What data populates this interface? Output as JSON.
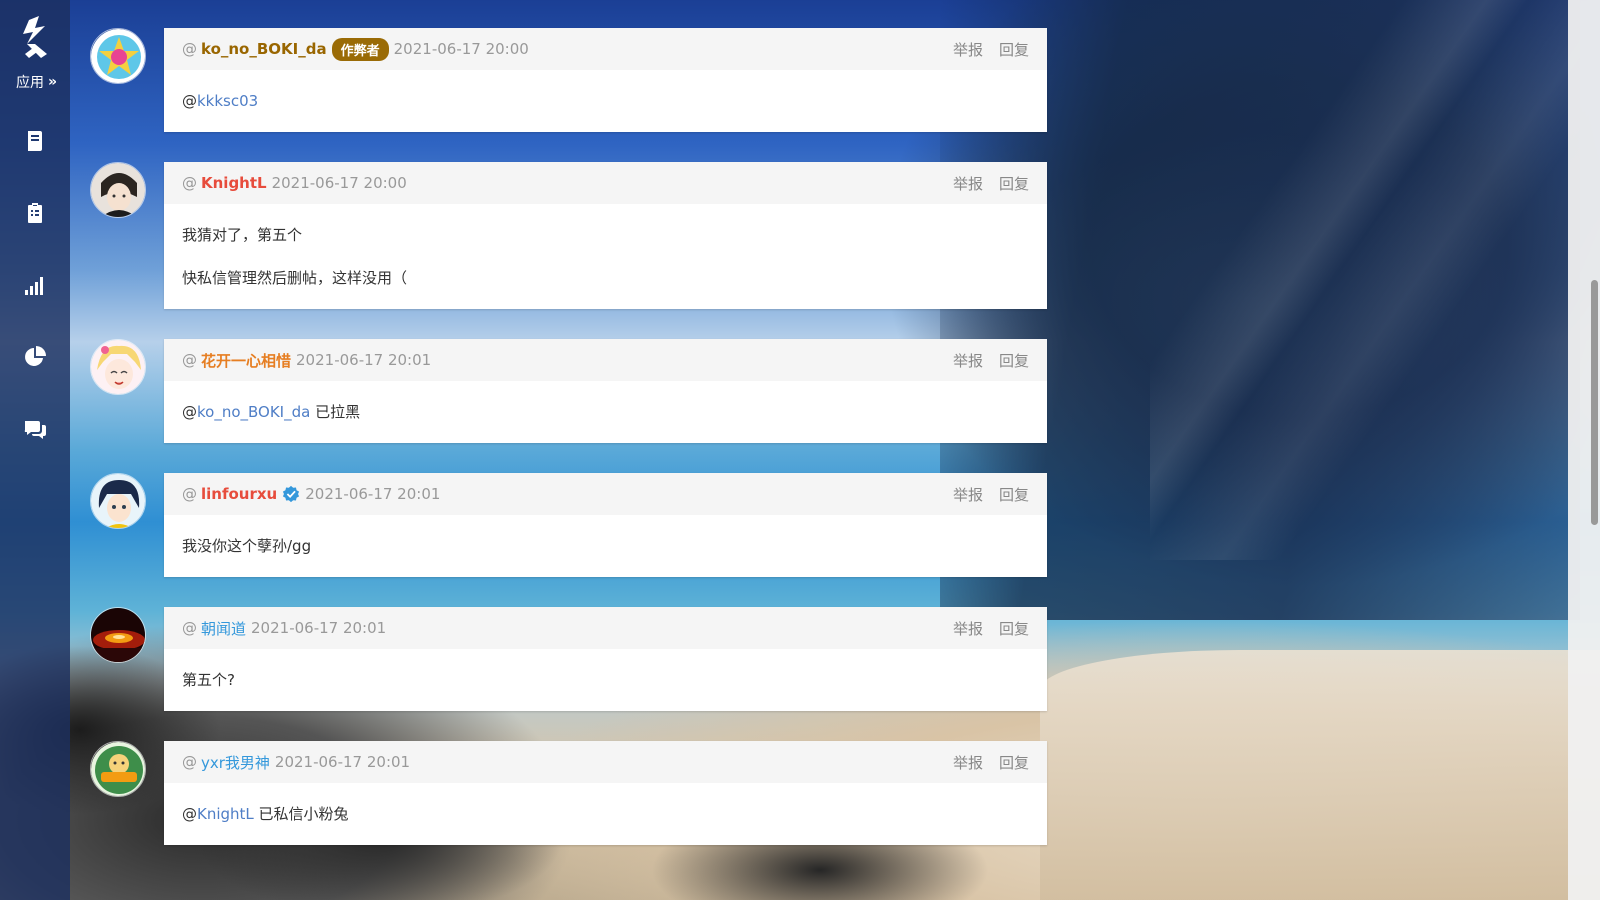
{
  "sidebar": {
    "logo_icon": "luogu-logo-icon",
    "app_label": "应用",
    "app_chevron": "»",
    "nav": [
      {
        "name": "problems-book-icon"
      },
      {
        "name": "clipboard-list-icon"
      },
      {
        "name": "signal-bars-icon"
      },
      {
        "name": "pie-chart-icon"
      },
      {
        "name": "comments-icon"
      }
    ]
  },
  "labels": {
    "at": "@",
    "report": "举报",
    "reply": "回复",
    "cheater_badge": "作弊者"
  },
  "comments": [
    {
      "username": "ko_no_BOKI_da",
      "name_color": "#996600",
      "badge": "作弊者",
      "time": "2021-06-17 20:00",
      "lines": [
        {
          "mention": "kkksc03",
          "text": ""
        }
      ]
    },
    {
      "username": "KnightL",
      "name_color": "#e74c3c",
      "time": "2021-06-17 20:00",
      "lines": [
        {
          "text": "我猜对了，第五个"
        },
        {
          "text": "快私信管理然后删帖，这样没用（"
        }
      ]
    },
    {
      "username": "花开一心相惜",
      "name_color": "#e67e22",
      "time": "2021-06-17 20:01",
      "lines": [
        {
          "mention": "ko_no_BOKI_da",
          "text": " 已拉黑"
        }
      ]
    },
    {
      "username": "linfourxu",
      "name_color": "#e74c3c",
      "verified": true,
      "time": "2021-06-17 20:01",
      "lines": [
        {
          "text": "我没你这个孽孙/gg"
        }
      ]
    },
    {
      "username": "朝闻道",
      "name_color": "#3498db",
      "time": "2021-06-17 20:01",
      "lines": [
        {
          "text": "第五个?"
        }
      ]
    },
    {
      "username": "yxr我男神",
      "name_color": "#3498db",
      "time": "2021-06-17 20:01",
      "lines": [
        {
          "mention": "KnightL",
          "text": " 已私信小粉兔"
        }
      ]
    }
  ],
  "colors": {
    "sidebar_bg": "#1c305f",
    "cheater_badge": "#9a6b06",
    "mention": "#4f7ec6",
    "verified": "#3498db"
  }
}
